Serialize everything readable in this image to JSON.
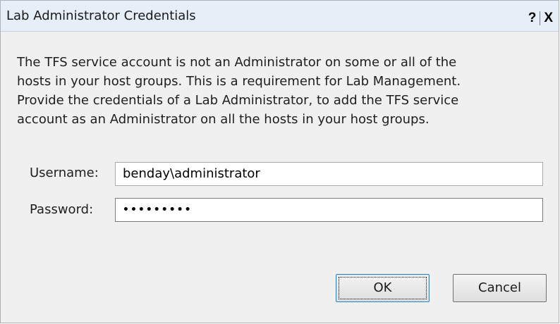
{
  "dialog": {
    "title": "Lab Administrator Credentials",
    "help_button": "?",
    "close_button": "X"
  },
  "message": {
    "line1": "The TFS service account is not an Administrator on some or all of the",
    "line2": "hosts in your host groups. This is a requirement for Lab Management.",
    "line3": "Provide the credentials of a Lab Administrator, to add the TFS service",
    "line4": "account as an Administrator on all the hosts in your host groups."
  },
  "form": {
    "username_label": "Username:",
    "username_value": "benday\\administrator",
    "password_label": "Password:",
    "password_value": "•••••••••"
  },
  "buttons": {
    "ok_label": "OK",
    "cancel_label": "Cancel"
  }
}
